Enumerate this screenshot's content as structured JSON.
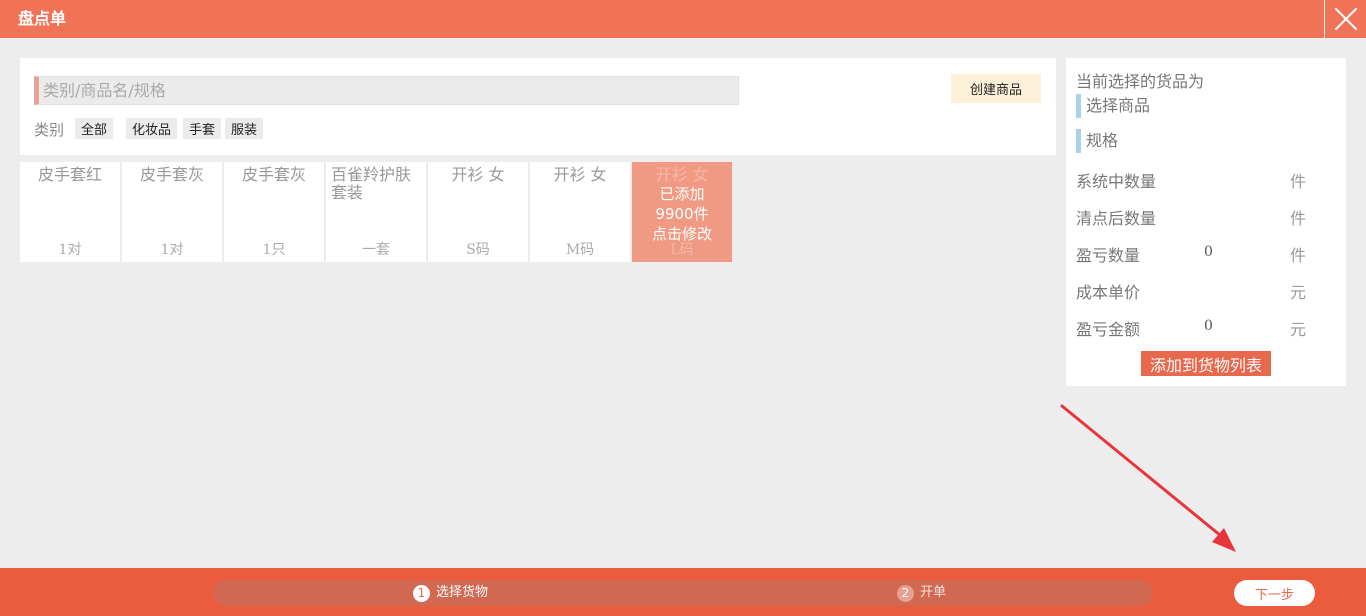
{
  "window": {
    "title": "盘点单"
  },
  "search": {
    "placeholder": "类别/商品名/规格",
    "create_label": "创建商品"
  },
  "categories": {
    "label": "类别",
    "items": [
      "全部",
      "化妆品",
      "手套",
      "服装"
    ]
  },
  "products": [
    {
      "name": "皮手套红",
      "spec": "1对"
    },
    {
      "name": "皮手套灰",
      "spec": "1对"
    },
    {
      "name": "皮手套灰",
      "spec": "1只"
    },
    {
      "name": "百雀羚护肤套装",
      "spec": "一套"
    },
    {
      "name": "开衫 女",
      "spec": "S码"
    },
    {
      "name": "开衫 女",
      "spec": "M码"
    },
    {
      "name": "开衫 女",
      "spec": "L码",
      "overlay": [
        "已添加",
        "9900件",
        "点击修改"
      ]
    }
  ],
  "side": {
    "title": "当前选择的货品为",
    "selected_product": "选择商品",
    "selected_spec": "规格",
    "rows": [
      {
        "label": "系统中数量",
        "value": "",
        "unit": "件"
      },
      {
        "label": "清点后数量",
        "value": "",
        "unit": "件"
      },
      {
        "label": "盈亏数量",
        "value": "0",
        "unit": "件"
      },
      {
        "label": "成本单价",
        "value": "",
        "unit": "元"
      },
      {
        "label": "盈亏金额",
        "value": "0",
        "unit": "元"
      }
    ],
    "add_label": "添加到货物列表"
  },
  "steps": [
    {
      "num": "1",
      "label": "选择货物",
      "active": true
    },
    {
      "num": "2",
      "label": "开单",
      "active": false
    }
  ],
  "next_label": "下一步",
  "colors": {
    "accent": "#f07357",
    "bottom": "#eb5c3f",
    "button": "#e8684d",
    "annotation_arrow": "#e8343b"
  }
}
